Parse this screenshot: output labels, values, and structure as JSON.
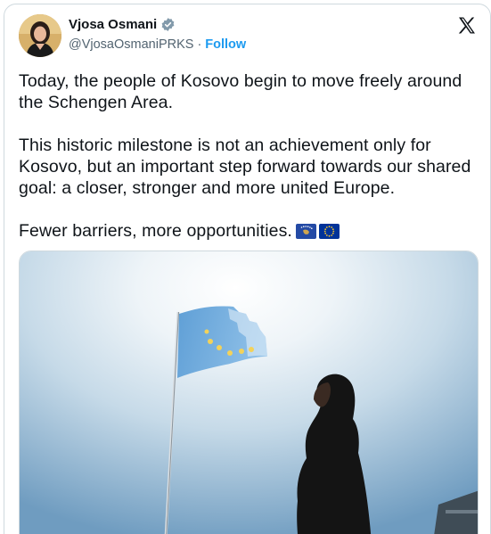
{
  "author": {
    "name": "Vjosa Osmani",
    "handle": "@VjosaOsmaniPRKS",
    "separator": "·",
    "follow_label": "Follow",
    "verified_icon": "verified-badge-icon"
  },
  "tweet": {
    "paragraph_1": "Today, the people of Kosovo begin to move freely around the Schengen Area.",
    "paragraph_2": "This historic milestone is not an achievement only for Kosovo, but an important step forward towards our shared goal: a closer, stronger and more united Europe.",
    "paragraph_3": "Fewer barriers, more opportunities.",
    "emojis": [
      "kosovo-flag-icon",
      "eu-flag-icon"
    ]
  },
  "colors": {
    "link_blue": "#1d9bf0",
    "muted_text": "#536471",
    "kosovo_blue": "#244aa5",
    "eu_blue": "#003399",
    "flag_gold": "#f4c430"
  },
  "media": {
    "icon": "photo-flag-woman"
  }
}
